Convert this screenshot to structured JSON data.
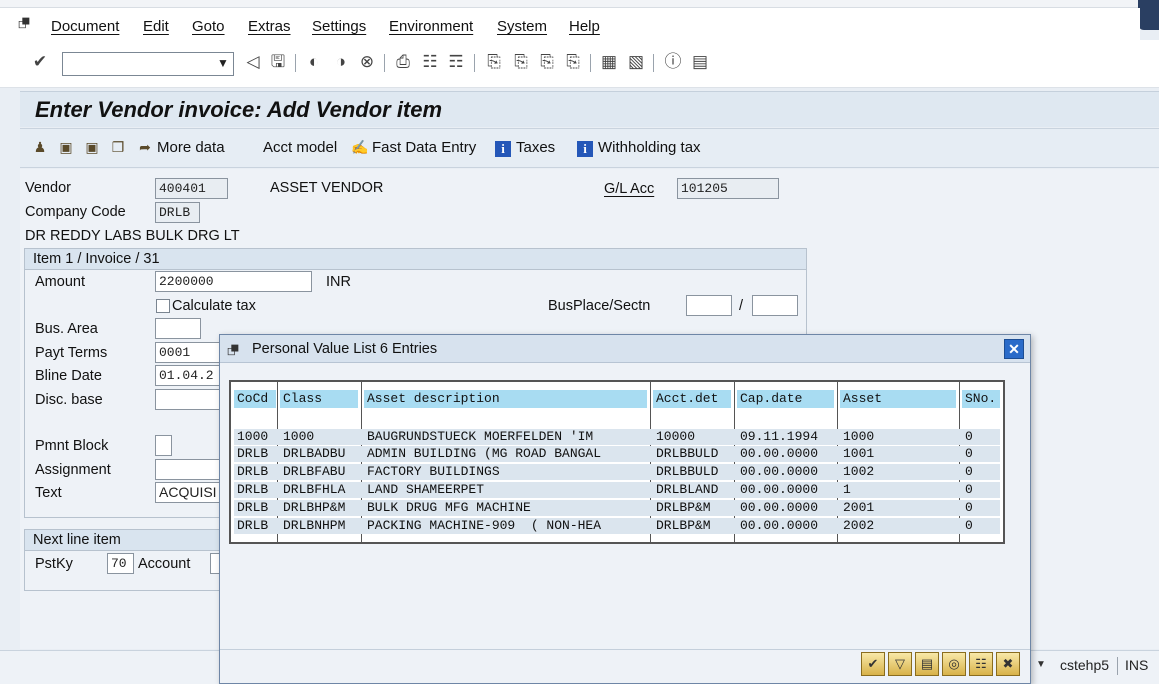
{
  "menu": {
    "items": [
      {
        "label": "Document"
      },
      {
        "label": "Edit"
      },
      {
        "label": "Goto"
      },
      {
        "label": "Extras"
      },
      {
        "label": "Settings"
      },
      {
        "label": "Environment"
      },
      {
        "label": "System"
      },
      {
        "label": "Help"
      }
    ]
  },
  "toolbar": {
    "command_value": ""
  },
  "page": {
    "title": "Enter Vendor invoice: Add Vendor item"
  },
  "app_toolbar": {
    "more_data": "More data",
    "acct_model": "Acct model",
    "fast_data_entry": "Fast Data Entry",
    "taxes": "Taxes",
    "withholding_tax": "Withholding tax",
    "info_glyph": "i"
  },
  "header": {
    "vendor_label": "Vendor",
    "vendor_value": "400401",
    "vendor_name": "ASSET VENDOR",
    "gl_label": "G/L Acc",
    "gl_value": "101205",
    "company_code_label": "Company Code",
    "company_code_value": "DRLB",
    "company_name": "DR REDDY LABS BULK DRG LT"
  },
  "item": {
    "group_title": "Item 1 / Invoice / 31",
    "amount_label": "Amount",
    "amount_value": "2200000",
    "currency": "INR",
    "calculate_tax_label": "Calculate tax",
    "busplace_label": "BusPlace/Sectn",
    "busplace_value": "",
    "busplace_sep": "/",
    "busplace_value2": "",
    "bus_area_label": "Bus. Area",
    "bus_area_value": "",
    "payt_terms_label": "Payt Terms",
    "payt_terms_value": "0001",
    "bline_date_label": "Bline Date",
    "bline_date_value": "01.04.2",
    "disc_base_label": "Disc. base",
    "disc_base_value": "",
    "pmnt_block_label": "Pmnt Block",
    "assignment_label": "Assignment",
    "assignment_value": "",
    "text_label": "Text",
    "text_value": "ACQUISI"
  },
  "next_line": {
    "group_title": "Next line item",
    "pstky_label": "PstKy",
    "pstky_value": "70",
    "account_label": "Account"
  },
  "status": {
    "system": "cstehp5",
    "mode": "INS"
  },
  "dialog": {
    "title": "Personal Value List 6 Entries",
    "columns": [
      "CoCd",
      "Class",
      "Asset description",
      "Acct.det",
      "Cap.date",
      "Asset",
      "SNo."
    ],
    "rows": [
      [
        "1000",
        "1000",
        "BAUGRUNDSTUECK MOERFELDEN 'IM",
        "10000",
        "09.11.1994",
        "1000",
        "0"
      ],
      [
        "DRLB",
        "DRLBADBU",
        "ADMIN BUILDING (MG ROAD BANGAL",
        "DRLBBULD",
        "00.00.0000",
        "1001",
        "0"
      ],
      [
        "DRLB",
        "DRLBFABU",
        "FACTORY BUILDINGS",
        "DRLBBULD",
        "00.00.0000",
        "1002",
        "0"
      ],
      [
        "DRLB",
        "DRLBFHLA",
        "LAND SHAMEERPET",
        "DRLBLAND",
        "00.00.0000",
        "1",
        "0"
      ],
      [
        "DRLB",
        "DRLBHP&M",
        "BULK DRUG MFG MACHINE",
        "DRLBP&M",
        "00.00.0000",
        "2001",
        "0"
      ],
      [
        "DRLB",
        "DRLBNHPM",
        "PACKING MACHINE-909  ( NON-HEA",
        "DRLBP&M",
        "00.00.0000",
        "2002",
        "0"
      ]
    ]
  },
  "colors": {
    "header_cell": "#a8dcf2",
    "row_band": "#dbe5ee",
    "title_band": "#dfe8f1",
    "close_button": "#2a6bc9"
  },
  "icons": {
    "menu": "exit-icon",
    "dialog_title": "exit-icon",
    "dialog_close": "close-icon"
  }
}
